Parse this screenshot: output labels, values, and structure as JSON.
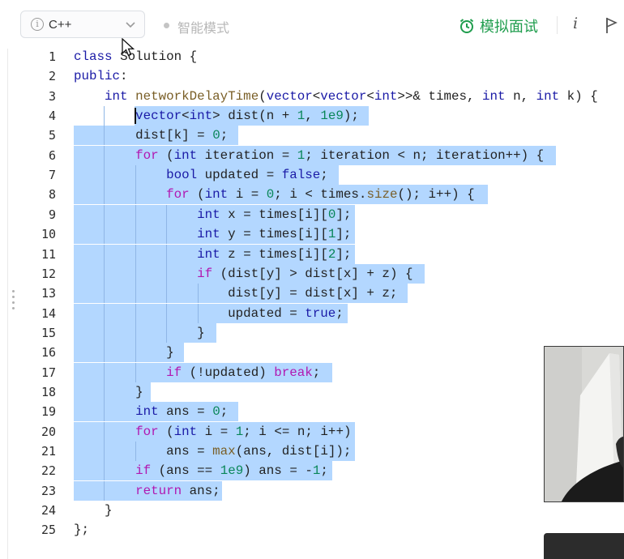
{
  "toolbar": {
    "language": "C++",
    "mode_label": "智能模式",
    "interview_label": "模拟面试",
    "info_label": "i"
  },
  "colors": {
    "keyword": "#1a1aa6",
    "function": "#795e26",
    "number": "#098658",
    "control": "#b118b1",
    "selection": "#b3d7ff",
    "interview_green": "#1f9d4d"
  },
  "editor": {
    "lines": [
      {
        "n": "1",
        "text": "class Solution {"
      },
      {
        "n": "2",
        "text": "public:"
      },
      {
        "n": "3",
        "text": "    int networkDelayTime(vector<vector<int>>& times, int n, int k) {"
      },
      {
        "n": "4",
        "text": "        vector<int> dist(n + 1, 1e9);"
      },
      {
        "n": "5",
        "text": "        dist[k] = 0;"
      },
      {
        "n": "6",
        "text": "        for (int iteration = 1; iteration < n; iteration++) {"
      },
      {
        "n": "7",
        "text": "            bool updated = false;"
      },
      {
        "n": "8",
        "text": "            for (int i = 0; i < times.size(); i++) {"
      },
      {
        "n": "9",
        "text": "                int x = times[i][0];"
      },
      {
        "n": "10",
        "text": "                int y = times[i][1];"
      },
      {
        "n": "11",
        "text": "                int z = times[i][2];"
      },
      {
        "n": "12",
        "text": "                if (dist[y] > dist[x] + z) {"
      },
      {
        "n": "13",
        "text": "                    dist[y] = dist[x] + z;"
      },
      {
        "n": "14",
        "text": "                    updated = true;"
      },
      {
        "n": "15",
        "text": "                }"
      },
      {
        "n": "16",
        "text": "            }"
      },
      {
        "n": "17",
        "text": "            if (!updated) break;"
      },
      {
        "n": "18",
        "text": "        }"
      },
      {
        "n": "19",
        "text": "        int ans = 0;"
      },
      {
        "n": "20",
        "text": "        for (int i = 1; i <= n; i++)"
      },
      {
        "n": "21",
        "text": "            ans = max(ans, dist[i]);"
      },
      {
        "n": "22",
        "text": "        if (ans == 1e9) ans = -1;"
      },
      {
        "n": "23",
        "text": "        return ans;"
      },
      {
        "n": "24",
        "text": "    }"
      },
      {
        "n": "25",
        "text": "};"
      }
    ]
  }
}
